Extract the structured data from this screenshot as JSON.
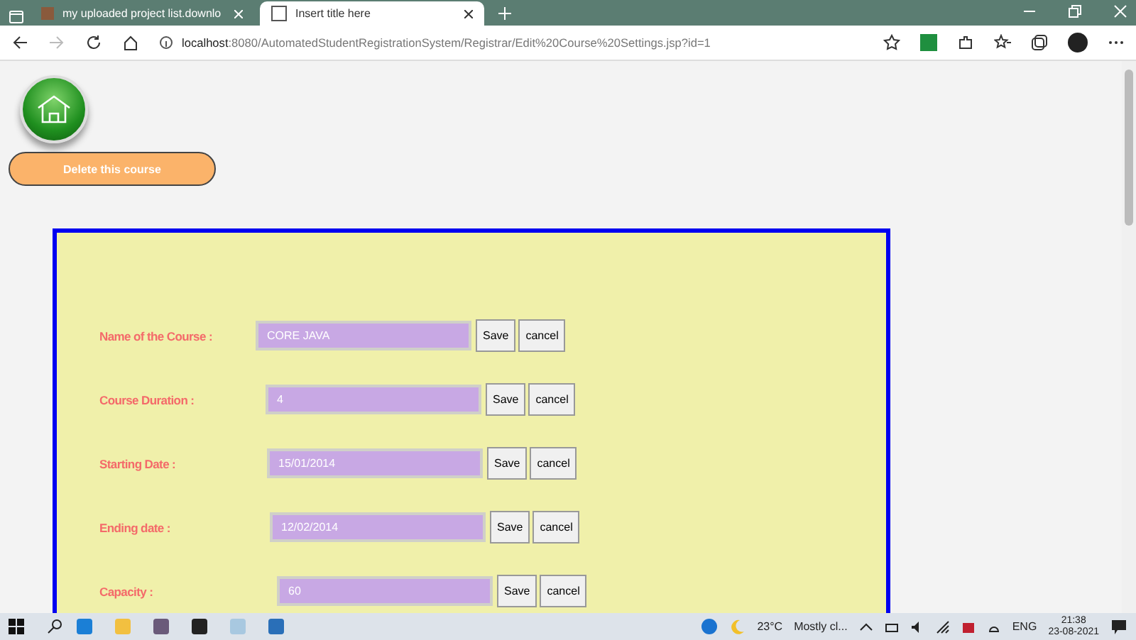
{
  "browser": {
    "tabs": [
      {
        "title": "my uploaded project list.downlo",
        "selected": false
      },
      {
        "title": "Insert title here",
        "selected": true
      }
    ],
    "address": {
      "host": "localhost",
      "path": ":8080/AutomatedStudentRegistrationSystem/Registrar/Edit%20Course%20Settings.jsp?id=1"
    }
  },
  "page": {
    "delete_button": "Delete this course",
    "fields": [
      {
        "label": "Name of the Course :",
        "value": "CORE JAVA",
        "save": "Save",
        "cancel": "cancel"
      },
      {
        "label": "Course Duration :",
        "value": "4",
        "save": "Save",
        "cancel": "cancel"
      },
      {
        "label": "Starting Date :",
        "value": "15/01/2014",
        "save": "Save",
        "cancel": "cancel"
      },
      {
        "label": "Ending date :",
        "value": "12/02/2014",
        "save": "Save",
        "cancel": "cancel"
      },
      {
        "label": "Capacity :",
        "value": "60",
        "save": "Save",
        "cancel": "cancel"
      }
    ]
  },
  "taskbar": {
    "temperature": "23°C",
    "weather": "Mostly cl...",
    "language": "ENG",
    "time": "21:38",
    "date": "23-08-2021"
  }
}
